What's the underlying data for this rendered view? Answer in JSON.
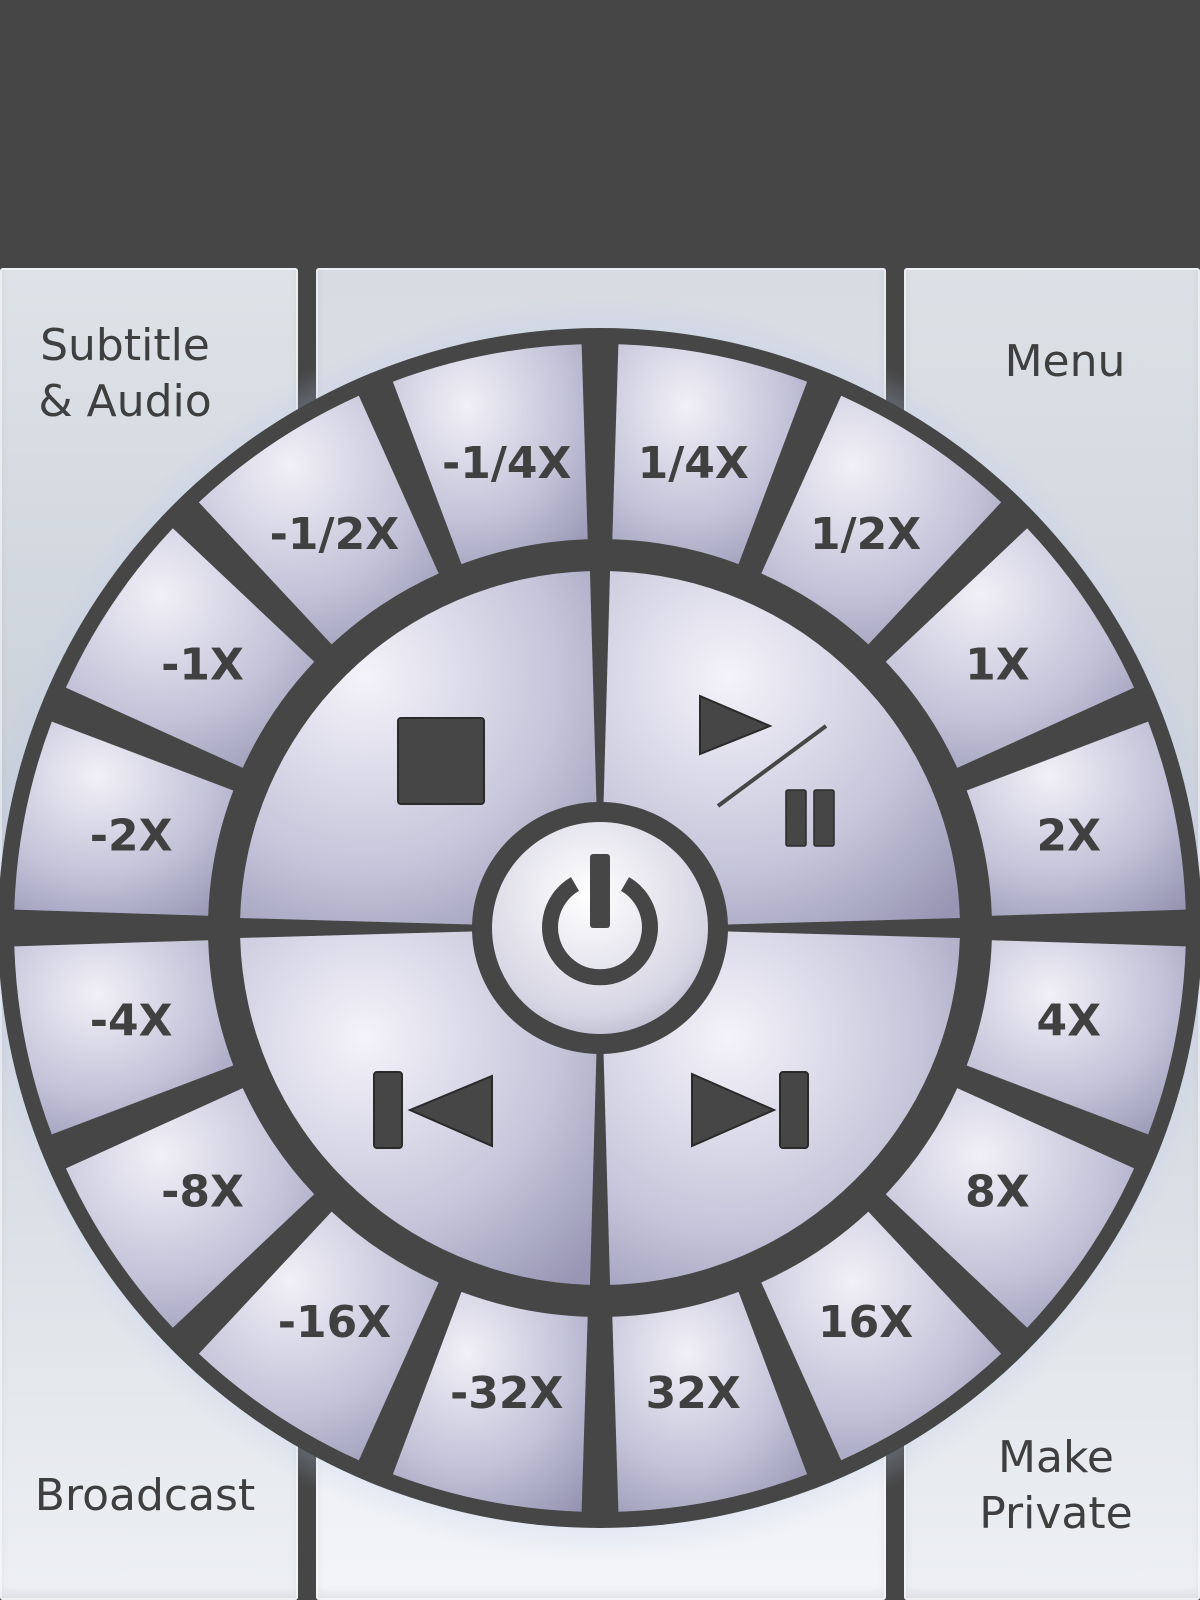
{
  "panels": {
    "subtitle_audio": [
      "Subtitle",
      "& Audio"
    ],
    "menu": "Menu",
    "broadcast": "Broadcast",
    "make_private": [
      "Make",
      "Private"
    ]
  },
  "speed_ring": {
    "right": [
      "1/4X",
      "1/2X",
      "1X",
      "2X",
      "4X",
      "8X",
      "16X",
      "32X"
    ],
    "left": [
      "-1/4X",
      "-1/2X",
      "-1X",
      "-2X",
      "-4X",
      "-8X",
      "-16X",
      "-32X"
    ]
  },
  "controls": {
    "top_left": "stop-icon",
    "top_right": "play-pause-icon",
    "bottom_left": "skip-previous-icon",
    "bottom_right": "skip-next-icon",
    "center": "power-icon"
  },
  "colors": {
    "frame": "#464646",
    "button_light": "#eceaf4",
    "button_dark": "#9a98b6",
    "label": "#404040"
  }
}
